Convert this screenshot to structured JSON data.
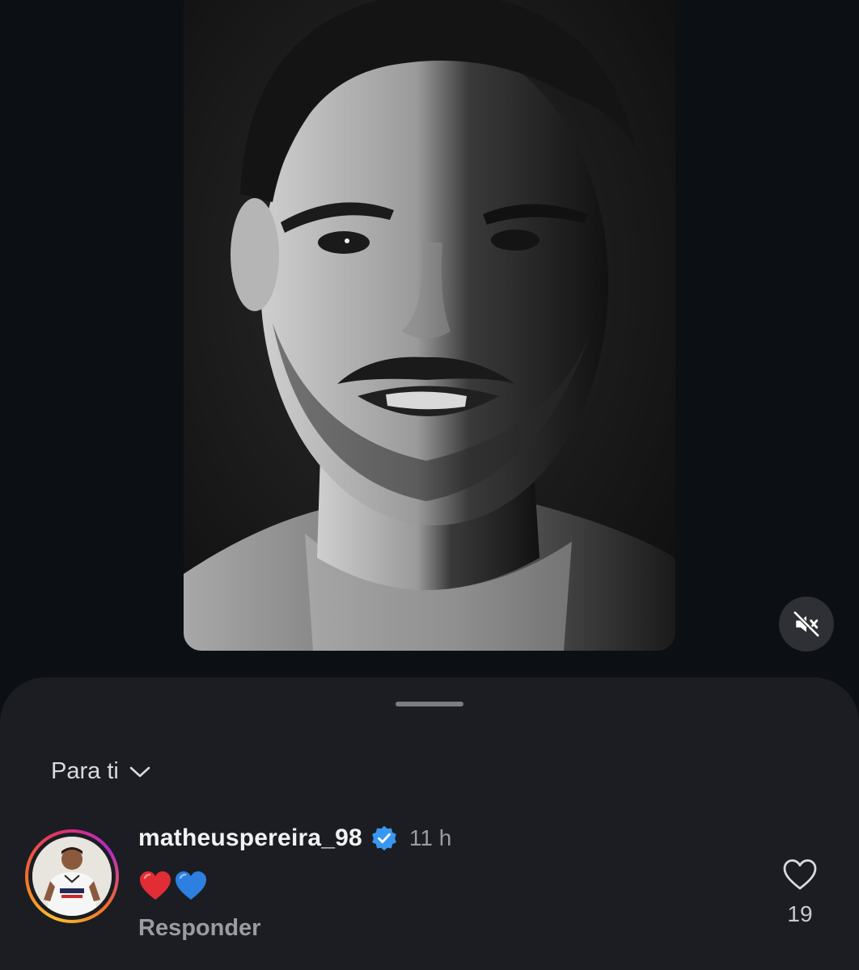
{
  "video": {
    "mute_icon": "speaker-muted-icon"
  },
  "sheet": {
    "filter_label": "Para ti",
    "filter_icon": "chevron-down-icon",
    "comments": [
      {
        "username": "matheuspereira_98",
        "verified": true,
        "time": "11 h",
        "text": "❤️💙",
        "reply_label": "Responder",
        "like_count": "19"
      }
    ]
  },
  "colors": {
    "background": "#0c0f14",
    "sheet": "#1b1d22",
    "verified_badge": "#3897f0",
    "secondary_text": "#9a9ca2"
  }
}
